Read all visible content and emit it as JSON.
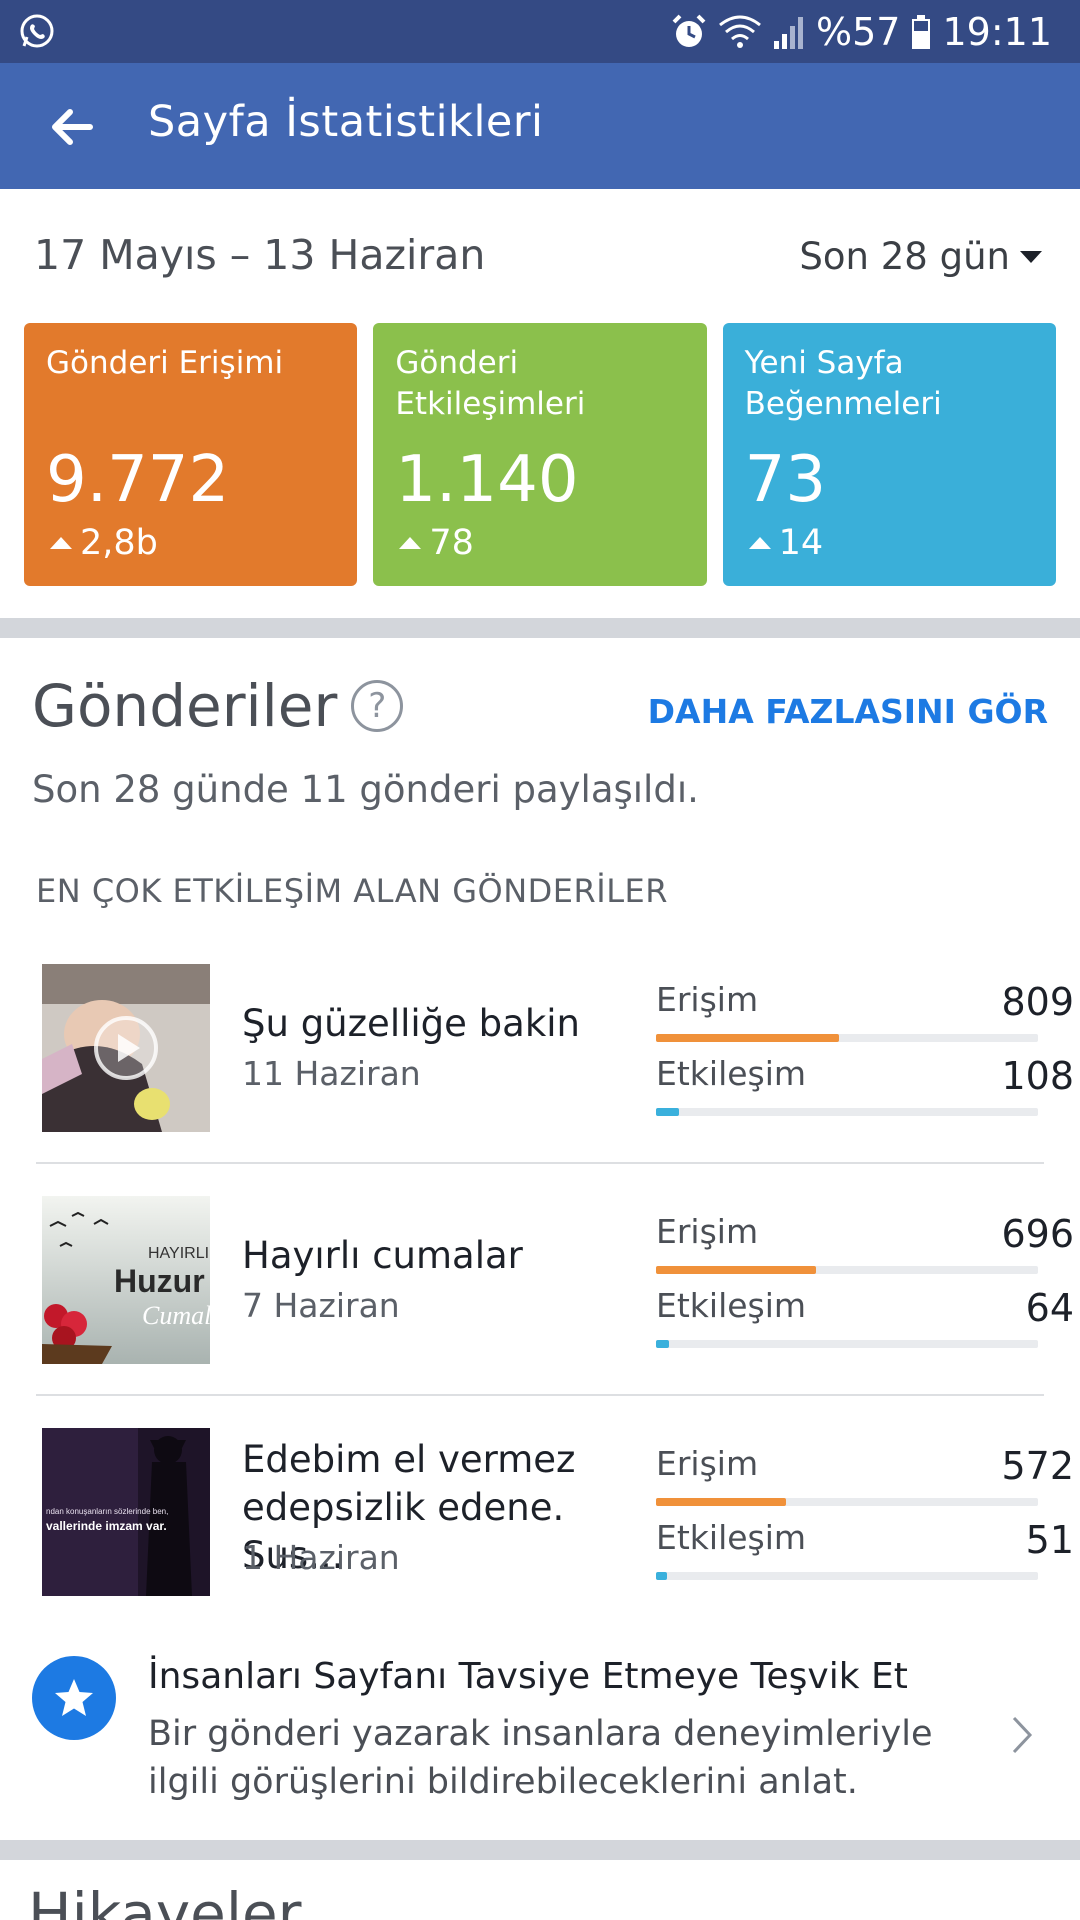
{
  "status_bar": {
    "battery_percent": "%57",
    "time": "19:11",
    "icons": [
      "whatsapp-icon",
      "alarm-icon",
      "wifi-icon",
      "signal-icon",
      "battery-icon"
    ]
  },
  "app_bar": {
    "title": "Sayfa İstatistikleri",
    "back_icon": "arrow-left-icon"
  },
  "date_range": {
    "label": "17 Mayıs – 13 Haziran",
    "period": "Son 28 gün"
  },
  "cards": [
    {
      "label": "Gönderi Erişimi",
      "value": "9.772",
      "delta": "2,8b",
      "color": "#e27a2c"
    },
    {
      "label": "Gönderi Etkileşimleri",
      "value": "1.140",
      "delta": "78",
      "color": "#8bc04c"
    },
    {
      "label": "Yeni Sayfa Beğenmeleri",
      "value": "73",
      "delta": "14",
      "color": "#3aafd9"
    }
  ],
  "posts_section": {
    "title": "Gönderiler",
    "help": "?",
    "see_more": "DAHA FAZLASINI GÖR",
    "summary": "Son 28 günde 11 gönderi paylaşıldı.",
    "caption": "EN ÇOK ETKİLEŞİM ALAN GÖNDERİLER",
    "reach_color": "#f0913a",
    "engagement_color": "#3ab0dc",
    "posts": [
      {
        "title": "Şu güzelliğe bakin",
        "date": "11 Haziran",
        "reach_label": "Erişim",
        "reach": "809",
        "reach_ratio": 0.48,
        "engagement_label": "Etkileşim",
        "engagement": "108",
        "engagement_ratio": 0.06
      },
      {
        "title": "Hayırlı cumalar",
        "date": "7 Haziran",
        "reach_label": "Erişim",
        "reach": "696",
        "reach_ratio": 0.42,
        "engagement_label": "Etkileşim",
        "engagement": "64",
        "engagement_ratio": 0.035
      },
      {
        "title": "Edebim el vermez edepsizlik edene. Sus...",
        "date": "1 Haziran",
        "reach_label": "Erişim",
        "reach": "572",
        "reach_ratio": 0.34,
        "engagement_label": "Etkileşim",
        "engagement": "51",
        "engagement_ratio": 0.03
      }
    ],
    "thumb_texts": {
      "post2_line1": "HAYIRLI VE",
      "post2_line2": "Huzur",
      "post2_line3": "Cumala",
      "post3_line1": "ndan konuşanların sözlerinde ben,",
      "post3_line2": "vallerinde imzam var."
    }
  },
  "promo": {
    "title": "İnsanları Sayfanı Tavsiye Etmeye Teşvik Et",
    "body": "Bir gönderi yazarak insanlara deneyimleriyle ilgili görüşlerini bildirebileceklerini anlat."
  },
  "next_section": {
    "title": "Hikayeler"
  }
}
